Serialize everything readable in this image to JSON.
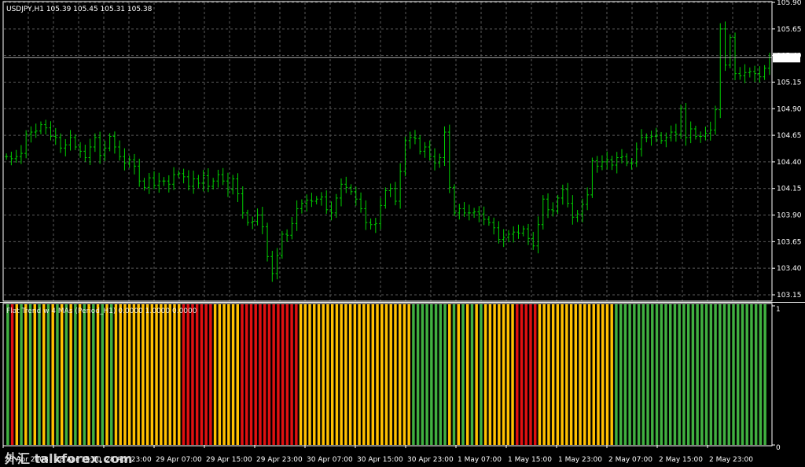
{
  "main_header": "USDJPY,H1  105.39 105.45 105.31 105.38",
  "indicator_header": "Flat Trend w 4 MAs (Period_H1) 0.0000 1.0000 0.0000",
  "current_price_label": "105.38",
  "indicator_axis_labels": [
    "1",
    "0"
  ],
  "watermark": "外汇 talkforex.com",
  "colors": {
    "background": "#000000",
    "grid": "#5a5a5a",
    "candle": "#00d000",
    "flat": "#ffc000",
    "down": "#e01010",
    "up": "#40b040",
    "text": "#ffffff"
  },
  "chart_data": [
    {
      "type": "line",
      "subtype": "ohlc-bars",
      "symbol": "USDJPY",
      "timeframe": "H1",
      "ylim": [
        103.15,
        105.9
      ],
      "yticks": [
        "105.90",
        "105.65",
        "105.40",
        "105.15",
        "104.90",
        "104.65",
        "104.40",
        "104.15",
        "103.90",
        "103.65",
        "103.40",
        "103.15"
      ],
      "xticks": [
        "28 Apr 2008",
        "28 Apr 15:00",
        "28 Apr 23:00",
        "29 Apr 07:00",
        "29 Apr 15:00",
        "29 Apr 23:00",
        "30 Apr 07:00",
        "30 Apr 15:00",
        "30 Apr 23:00",
        "1 May 07:00",
        "1 May 15:00",
        "1 May 23:00",
        "2 May 07:00",
        "2 May 15:00",
        "2 May 23:00"
      ],
      "series": [
        {
          "closes": [
            104.45,
            104.43,
            104.45,
            104.48,
            104.66,
            104.68,
            104.69,
            104.75,
            104.72,
            104.64,
            104.63,
            104.53,
            104.56,
            104.63,
            104.54,
            104.5,
            104.44,
            104.54,
            104.63,
            104.46,
            104.53,
            104.64,
            104.54,
            104.45,
            104.39,
            104.42,
            104.36,
            104.22,
            104.16,
            104.25,
            104.18,
            104.22,
            104.22,
            104.19,
            104.28,
            104.29,
            104.26,
            104.17,
            104.24,
            104.2,
            104.27,
            104.17,
            104.22,
            104.28,
            104.22,
            104.14,
            104.24,
            104.1,
            103.92,
            103.83,
            103.84,
            103.9,
            103.79,
            103.51,
            103.35,
            103.52,
            103.72,
            103.71,
            103.82,
            103.96,
            104.01,
            104.04,
            104.03,
            104.05,
            104.07,
            103.95,
            103.92,
            104.06,
            104.19,
            104.16,
            104.12,
            104.05,
            103.96,
            103.83,
            103.81,
            103.82,
            103.99,
            104.13,
            104.15,
            104.03,
            104.31,
            104.6,
            104.63,
            104.62,
            104.5,
            104.54,
            104.45,
            104.39,
            104.44,
            104.68,
            104.16,
            103.92,
            103.96,
            103.92,
            103.92,
            103.93,
            103.91,
            103.86,
            103.83,
            103.78,
            103.67,
            103.69,
            103.72,
            103.74,
            103.73,
            103.77,
            103.68,
            103.61,
            103.81,
            104.05,
            103.95,
            103.94,
            104.06,
            104.14,
            104.01,
            103.88,
            103.91,
            104.0,
            104.09,
            104.41,
            104.36,
            104.4,
            104.42,
            104.37,
            104.44,
            104.45,
            104.39,
            104.39,
            104.52,
            104.63,
            104.63,
            104.64,
            104.65,
            104.6,
            104.63,
            104.68,
            104.66,
            104.9,
            104.63,
            104.71,
            104.64,
            104.64,
            104.67,
            104.7,
            104.89,
            105.65,
            105.31,
            105.57,
            105.23,
            105.21,
            105.24,
            105.25,
            105.23,
            105.2,
            105.28,
            105.38
          ]
        }
      ]
    },
    {
      "type": "bar",
      "name": "Flat Trend w 4 MAs",
      "ylim": [
        0,
        1
      ],
      "note_states": "0 = flat (yellow), 1 = down (red), 2 = up (green)",
      "states": [
        2,
        1,
        0,
        2,
        0,
        2,
        0,
        2,
        0,
        2,
        0,
        2,
        0,
        2,
        0,
        2,
        0,
        2,
        0,
        2,
        0,
        2,
        0,
        2,
        0,
        0,
        0,
        0,
        0,
        0,
        0,
        0,
        0,
        0,
        0,
        0,
        0,
        0,
        0,
        1,
        1,
        1,
        1,
        1,
        1,
        1,
        0,
        0,
        0,
        0,
        0,
        0,
        1,
        1,
        1,
        1,
        1,
        1,
        1,
        1,
        1,
        1,
        1,
        1,
        1,
        0,
        0,
        0,
        0,
        0,
        0,
        0,
        0,
        0,
        0,
        0,
        0,
        0,
        0,
        0,
        0,
        0,
        0,
        0,
        0,
        0,
        0,
        0,
        0,
        0,
        2,
        2,
        2,
        2,
        2,
        2,
        2,
        2,
        0,
        2,
        0,
        2,
        0,
        2,
        0,
        2,
        0,
        0,
        0,
        0,
        0,
        0,
        0,
        1,
        1,
        1,
        1,
        1,
        0,
        0,
        0,
        0,
        0,
        0,
        0,
        0,
        0,
        0,
        0,
        0,
        0,
        0,
        0,
        0,
        0,
        2,
        2,
        2,
        2,
        2,
        2,
        2,
        2,
        2,
        2,
        2,
        2,
        2,
        2,
        2,
        2,
        2,
        2,
        2,
        2,
        2,
        2,
        2,
        2,
        2,
        2,
        2,
        2,
        2,
        2,
        2,
        2,
        2,
        2
      ]
    }
  ]
}
